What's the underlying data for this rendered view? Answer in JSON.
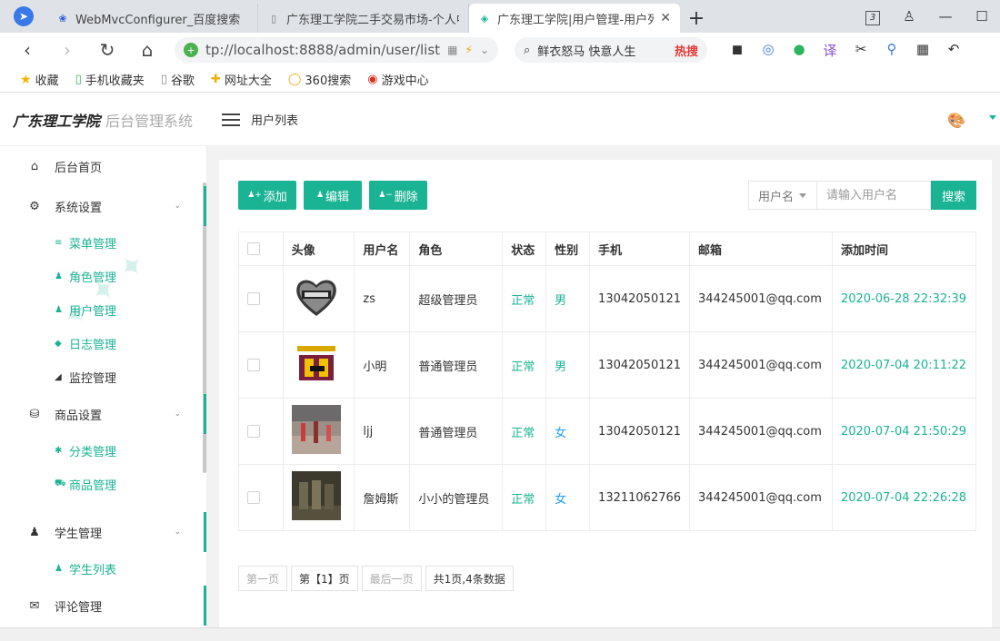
{
  "browser": {
    "tabs": [
      {
        "title": "WebMvcConfigurer_百度搜索",
        "icon": "paw-icon"
      },
      {
        "title": "广东理工学院二手交易市场-个人中心",
        "icon": "page-icon"
      },
      {
        "title": "广东理工学院|用户管理-用户列表",
        "icon": "diamond-icon",
        "close": "✕"
      }
    ],
    "tab_count": "3",
    "url": "tp://localhost:8888/admin/user/list",
    "search_text": "鲜衣怒马 快意人生",
    "search_hot": "热搜",
    "bookmarks": [
      "收藏",
      "手机收藏夹",
      "谷歌",
      "网址大全",
      "360搜索",
      "游戏中心"
    ]
  },
  "app": {
    "logo_main": "广东理工学院",
    "logo_sub": "后台管理系统",
    "breadcrumb": "用户列表"
  },
  "sidebar": {
    "home": "后台首页",
    "groups": [
      {
        "label": "系统设置",
        "items": [
          "菜单管理",
          "角色管理",
          "用户管理",
          "日志管理",
          "监控管理"
        ]
      },
      {
        "label": "商品设置",
        "items": [
          "分类管理",
          "商品管理"
        ]
      },
      {
        "label": "学生管理",
        "items": [
          "学生列表"
        ]
      },
      {
        "label": "评论管理",
        "items": []
      }
    ]
  },
  "toolbar": {
    "add": "添加",
    "edit": "编辑",
    "delete": "删除",
    "filter_label": "用户名",
    "search_placeholder": "请输入用户名",
    "search_button": "搜索"
  },
  "table": {
    "headers": [
      "头像",
      "用户名",
      "角色",
      "状态",
      "性别",
      "手机",
      "邮箱",
      "添加时间"
    ],
    "rows": [
      {
        "username": "zs",
        "role": "超级管理员",
        "status": "正常",
        "gender": "男",
        "phone": "13042050121",
        "email": "344245001@qq.com",
        "time": "2020-06-28 22:32:39",
        "avatar": "lebron-heart"
      },
      {
        "username": "小明",
        "role": "普通管理员",
        "status": "正常",
        "gender": "男",
        "phone": "13042050121",
        "email": "344245001@qq.com",
        "time": "2020-07-04 20:11:22",
        "avatar": "lebron-23"
      },
      {
        "username": "ljj",
        "role": "普通管理员",
        "status": "正常",
        "gender": "女",
        "phone": "13042050121",
        "email": "344245001@qq.com",
        "time": "2020-07-04 21:50:29",
        "avatar": "street-photo"
      },
      {
        "username": "詹姆斯",
        "role": "小小的管理员",
        "status": "正常",
        "gender": "女",
        "phone": "13211062766",
        "email": "344245001@qq.com",
        "time": "2020-07-04 22:26:28",
        "avatar": "soldiers-photo"
      }
    ]
  },
  "pager": {
    "first": "第一页",
    "current": "第【1】页",
    "last": "最后一页",
    "summary": "共1页,4条数据"
  },
  "colors": {
    "accent": "#1ab394",
    "male": "#1ab394",
    "female": "#1e9fff"
  }
}
